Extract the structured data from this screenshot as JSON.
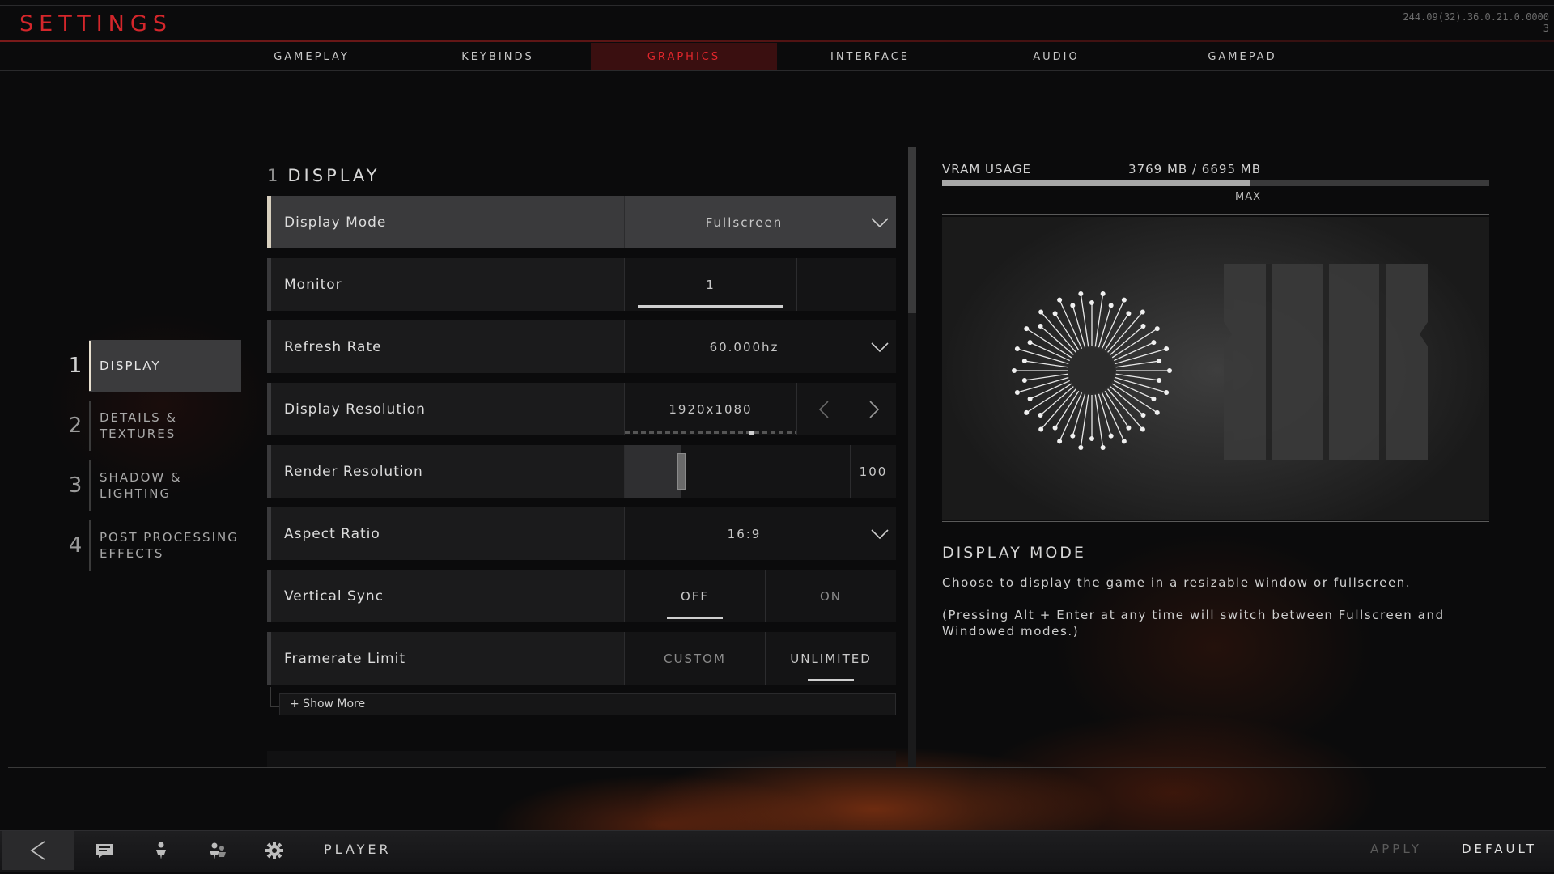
{
  "app": {
    "title": "SETTINGS",
    "build": [
      "244.09(32).36.0.21.0.0000",
      "3"
    ]
  },
  "tabs": [
    {
      "label": "GAMEPLAY"
    },
    {
      "label": "KEYBINDS"
    },
    {
      "label": "GRAPHICS",
      "active": true
    },
    {
      "label": "INTERFACE"
    },
    {
      "label": "AUDIO"
    },
    {
      "label": "GAMEPAD"
    }
  ],
  "categories": [
    {
      "num": "1",
      "label": "DISPLAY",
      "active": true
    },
    {
      "num": "2",
      "label": "DETAILS &\nTEXTURES"
    },
    {
      "num": "3",
      "label": "SHADOW &\nLIGHTING"
    },
    {
      "num": "4",
      "label": "POST PROCESSING\nEFFECTS"
    }
  ],
  "section": {
    "num": "1",
    "title": "DISPLAY"
  },
  "settings": {
    "display_mode": {
      "label": "Display Mode",
      "value": "Fullscreen"
    },
    "monitor": {
      "label": "Monitor",
      "value": "1"
    },
    "refresh_rate": {
      "label": "Refresh Rate",
      "value": "60.000hz"
    },
    "display_resolution": {
      "label": "Display Resolution",
      "value": "1920x1080"
    },
    "render_resolution": {
      "label": "Render Resolution",
      "value": "100",
      "fill_fraction": 0.25
    },
    "aspect_ratio": {
      "label": "Aspect Ratio",
      "value": "16:9"
    },
    "vertical_sync": {
      "label": "Vertical Sync",
      "options": [
        "OFF",
        "ON"
      ],
      "selected": "OFF"
    },
    "framerate_limit": {
      "label": "Framerate Limit",
      "options": [
        "CUSTOM",
        "UNLIMITED"
      ],
      "selected": "UNLIMITED"
    }
  },
  "show_more": "+ Show More",
  "vram": {
    "label": "VRAM USAGE",
    "value": "3769 MB / 6695 MB",
    "used_fraction": 0.563,
    "max_label": "MAX"
  },
  "description": {
    "title": "DISPLAY MODE",
    "text": "Choose to display the game in a resizable window or fullscreen.",
    "note": "(Pressing Alt + Enter at any time will switch between Fullscreen and Windowed modes.)"
  },
  "bottom": {
    "player": "PLAYER",
    "apply": "APPLY",
    "default": "DEFAULT"
  },
  "colors": {
    "accent": "#d4262b",
    "active_tab_bg": "#3a0f10"
  }
}
